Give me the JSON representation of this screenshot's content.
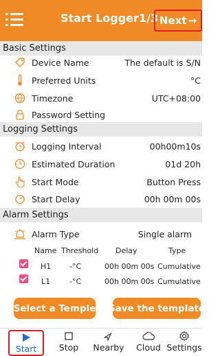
{
  "header": {
    "title": "Start Logger1/3",
    "next_label": "Next",
    "next_arrow": "→",
    "colors": {
      "bar": "#f08a24",
      "text": "#ffffff",
      "highlight": "#e01b24"
    }
  },
  "basic": {
    "section_title": "Basic Settings",
    "items": [
      {
        "label": "Device Name",
        "value": "The default  is  S/N",
        "icon": "tag-icon"
      },
      {
        "label": "Preferred Units",
        "value": "°C",
        "icon": "thermometer-icon"
      },
      {
        "label": "Timezone",
        "value": "UTC+08:00",
        "icon": "globe-icon"
      },
      {
        "label": "Password Setting",
        "value": "",
        "icon": "lock-icon"
      }
    ]
  },
  "logging": {
    "section_title": "Logging Settings",
    "items": [
      {
        "label": "Logging Interval",
        "value": "00h00m10s",
        "icon": "alarm-clock-icon"
      },
      {
        "label": "Estimated Duration",
        "value": "01d 20h",
        "icon": "clock-icon"
      },
      {
        "label": "Start Mode",
        "value": "Button Press",
        "icon": "hand-pointer-icon"
      },
      {
        "label": "Start Delay",
        "value": "00h 00m 00s",
        "icon": "timer-icon"
      }
    ]
  },
  "alarm": {
    "section_title": "Alarm Settings",
    "type_label": "Alarm Type",
    "type_value": "Single alarm",
    "type_icon": "alarm-icon",
    "columns": [
      "Name",
      "Threshold",
      "Delay",
      "Type"
    ],
    "rows": [
      {
        "checked": true,
        "name": "H1",
        "threshold": "-°C",
        "delay": "00h 00m 00s",
        "type": "Cumulative"
      },
      {
        "checked": true,
        "name": "L1",
        "threshold": "-°C",
        "delay": "00h 00m 00s",
        "type": "Cumulative"
      }
    ],
    "checkbox_color": "#ec4f86"
  },
  "buttons": {
    "select_template": "Select a Temple",
    "save_template": "Save the template"
  },
  "bottom_nav": {
    "items": [
      {
        "label": "Start",
        "icon": "play-icon",
        "active": true
      },
      {
        "label": "Stop",
        "icon": "stop-square-icon",
        "active": false
      },
      {
        "label": "Nearby",
        "icon": "compass-icon",
        "active": false
      },
      {
        "label": "Cloud",
        "icon": "cloud-icon",
        "active": false
      },
      {
        "label": "Settings",
        "icon": "gear-icon",
        "active": false
      }
    ],
    "active_color": "#1a6fd4"
  }
}
